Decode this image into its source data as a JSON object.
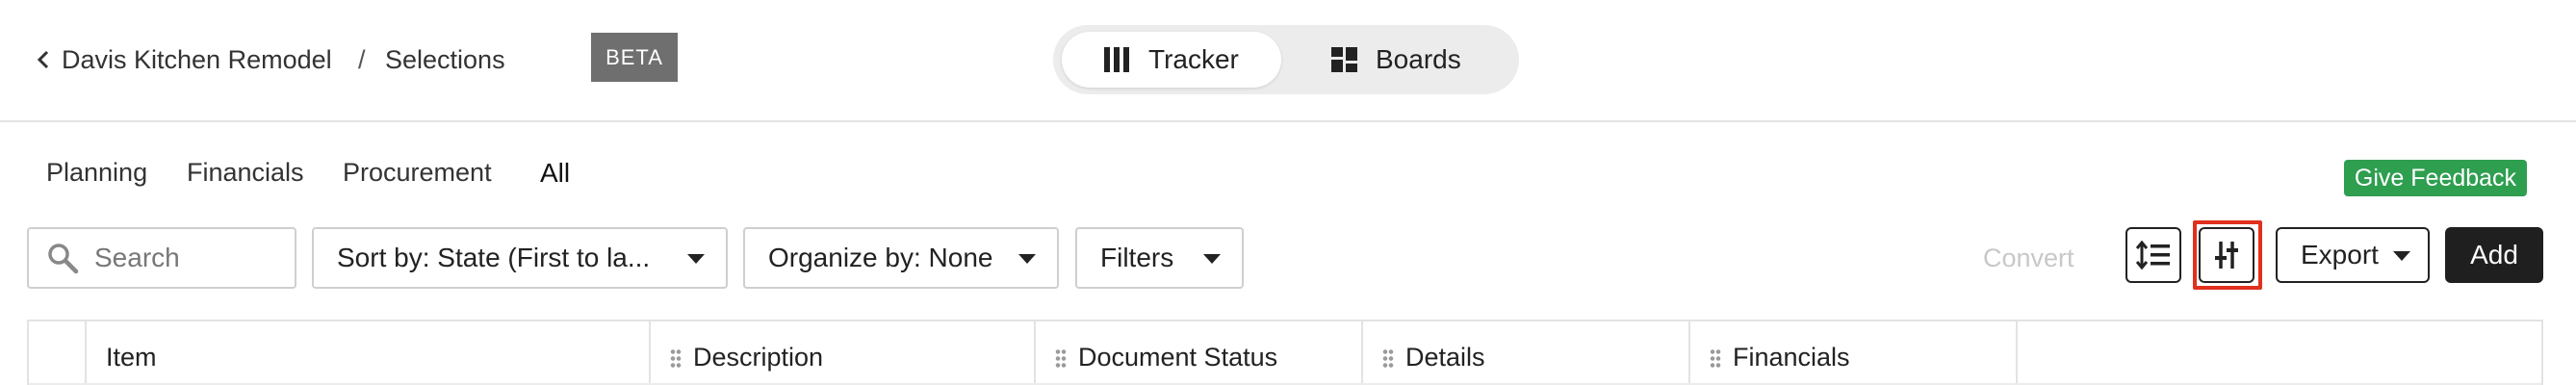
{
  "breadcrumb": {
    "project": "Davis Kitchen Remodel",
    "separator": "/",
    "page": "Selections",
    "badge": "BETA"
  },
  "view_switch": {
    "tracker_label": "Tracker",
    "boards_label": "Boards",
    "active": "Tracker"
  },
  "tabs": [
    {
      "label": "Planning"
    },
    {
      "label": "Financials"
    },
    {
      "label": "Procurement"
    },
    {
      "label": "All",
      "active": true
    }
  ],
  "feedback_label": "Give Feedback",
  "toolbar": {
    "search_placeholder": "Search",
    "sort_label": "Sort by: State (First to la...",
    "organize_label": "Organize by: None",
    "filters_label": "Filters",
    "convert_label": "Convert",
    "export_label": "Export",
    "add_label": "Add"
  },
  "table": {
    "columns": [
      "Item",
      "Description",
      "Document Status",
      "Details",
      "Financials"
    ]
  },
  "colors": {
    "feedback_green": "#2e9e4f",
    "add_button": "#1f1f1f",
    "highlight_red": "#e0301e",
    "beta_badge": "#6f6f6f"
  },
  "icons": [
    "chevron-left-icon",
    "tracker-columns-icon",
    "boards-grid-icon",
    "search-icon",
    "row-density-icon",
    "column-settings-icon"
  ]
}
